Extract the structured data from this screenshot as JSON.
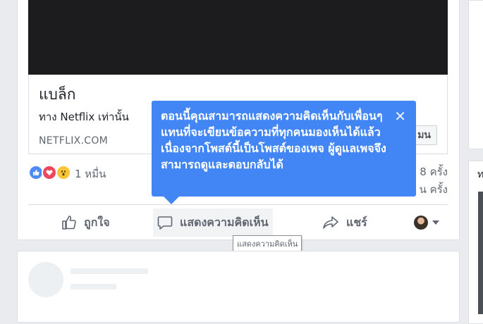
{
  "link_preview": {
    "title": "แบล็ก",
    "subtitle": "ทาง Netflix เท่านั้น",
    "domain": "NETFLIX.COM",
    "button_label": "มน"
  },
  "reactions": {
    "icons": [
      "like-icon",
      "love-icon",
      "wow-icon"
    ],
    "count_text": "1 หมื่น",
    "right_line1": "8 ครั้ง",
    "right_line2": "น ครั้ง"
  },
  "actions": {
    "like_label": "ถูกใจ",
    "comment_label": "แสดงความคิดเห็น",
    "share_label": "แชร์"
  },
  "hover_tooltip": "แสดงความคิดเห็น",
  "popover": {
    "text": "ตอนนี้คุณสามารถแสดงความคิดเห็นกับเพื่อนๆ แทนที่จะเขียนข้อความที่ทุกคนมองเห็นได้แล้ว เนื่องจากโพสต์นี้เป็นโพสต์ของเพจ ผู้ดูแลเพจจึงสามารถดูและตอบกลับได้",
    "close_glyph": "✕"
  },
  "right_column": {
    "fragment": "ท"
  },
  "colors": {
    "accent_blue": "#4286f5",
    "page_bg": "#e9ebee",
    "video_bg": "#1c1c1e"
  }
}
